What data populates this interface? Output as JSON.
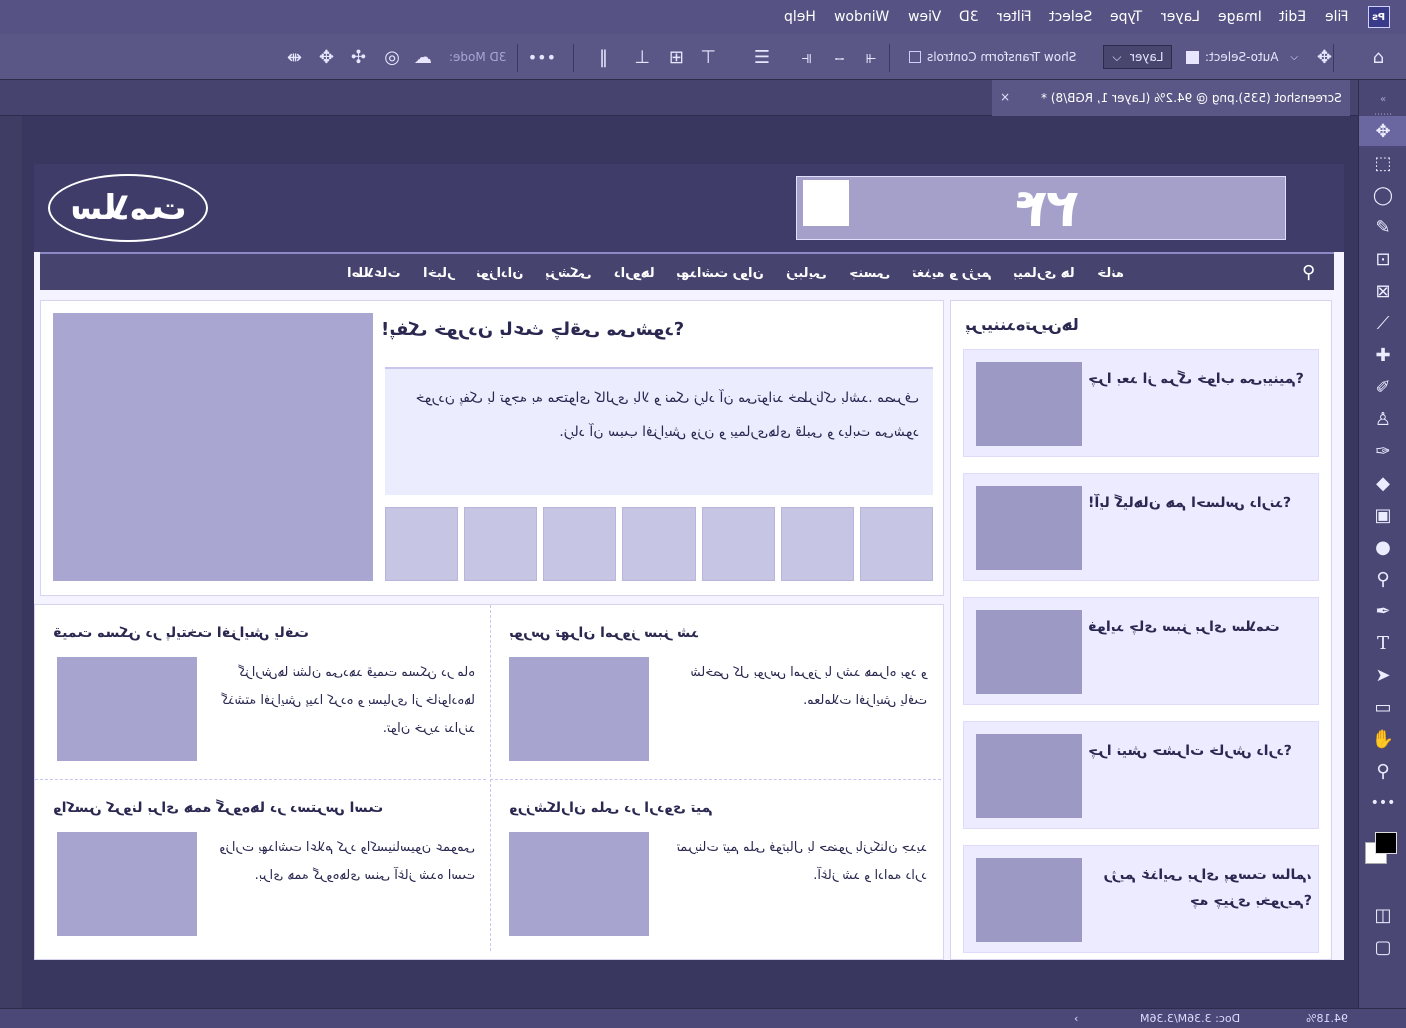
{
  "menubar": {
    "items": [
      "File",
      "Edit",
      "Image",
      "Layer",
      "Type",
      "Select",
      "Filter",
      "3D",
      "View",
      "Window",
      "Help"
    ],
    "logo": "Ps"
  },
  "options_bar": {
    "auto_select_label": "Auto-Select:",
    "auto_select_value": "Layer",
    "show_transform_label": "Show Transform Controls",
    "mode_label": "3D Mode:",
    "more": "•••"
  },
  "document_tab": {
    "title": "Screenshot (535).png @ 94.2% (Layer 1, RGB/8) *",
    "close": "×"
  },
  "status": {
    "zoom": "94.18%",
    "doc_size": "Doc: 3.36M/3.36M",
    "arrow": "›"
  },
  "page": {
    "logo_text": "سلامت",
    "banner_text": "۲۴",
    "nav": [
      "خانه",
      "بیماری ها",
      "تغذیه و رژیم",
      "جنسی",
      "زیبایی",
      "بهداشت روان",
      "داروها",
      "پزشکی",
      "نوزادان",
      "اخبار",
      "اطلاعات"
    ],
    "featured": {
      "title": "پفک خوردن باعث چاقی می‌شود؟!",
      "body": "خوردن پفک با توجه به محتوای کالری بالا و نمک زیاد آن می‌تواند خطرناک باشد. مصرف زیاد آن سبب افزایش وزن و بیماری‌های قلبی و دیابت می‌شود.",
      "thumbs": 7
    },
    "mostread": {
      "title": "پربیننده‌ترین‌ها",
      "items": [
        "چرا بعد از مرگ خواب می‌بینیم؟",
        "آیا گیاهان هم احساس دارند؟!",
        "فواید چای سبز برای سلامت",
        "چرا نیش حشرات خارش دارد؟",
        "رژیم غذایی برای پوست سالم، چه چیزی بخوریم؟"
      ]
    },
    "grid": [
      {
        "title": "قیمت مسکن در پایتخت افزایش یافت",
        "text": "گزارش‌ها نشان می‌دهد قیمت مسکن در ماه گذشته افزایش پیدا کرده و بسیاری از خانواده‌ها توان خرید ندارند."
      },
      {
        "title": "بورس تهران امروز سبز شد",
        "text": "شاخص کل بورس امروز با رشد همراه بود و معاملات افزایش یافت."
      },
      {
        "title": "واکسن کرونا برای همه گروه‌ها در دسترس است",
        "text": "وزارت بهداشت اعلام کرد واکسیناسیون عمومی برای همه گروه‌های سنی آغاز شده است."
      },
      {
        "title": "ورزشکاران ملی در اردوی تیم",
        "text": "تمرینات تیم ملی فوتبال با حضور بازیکنان جدید آغاز شد و ادامه دارد."
      }
    ]
  }
}
